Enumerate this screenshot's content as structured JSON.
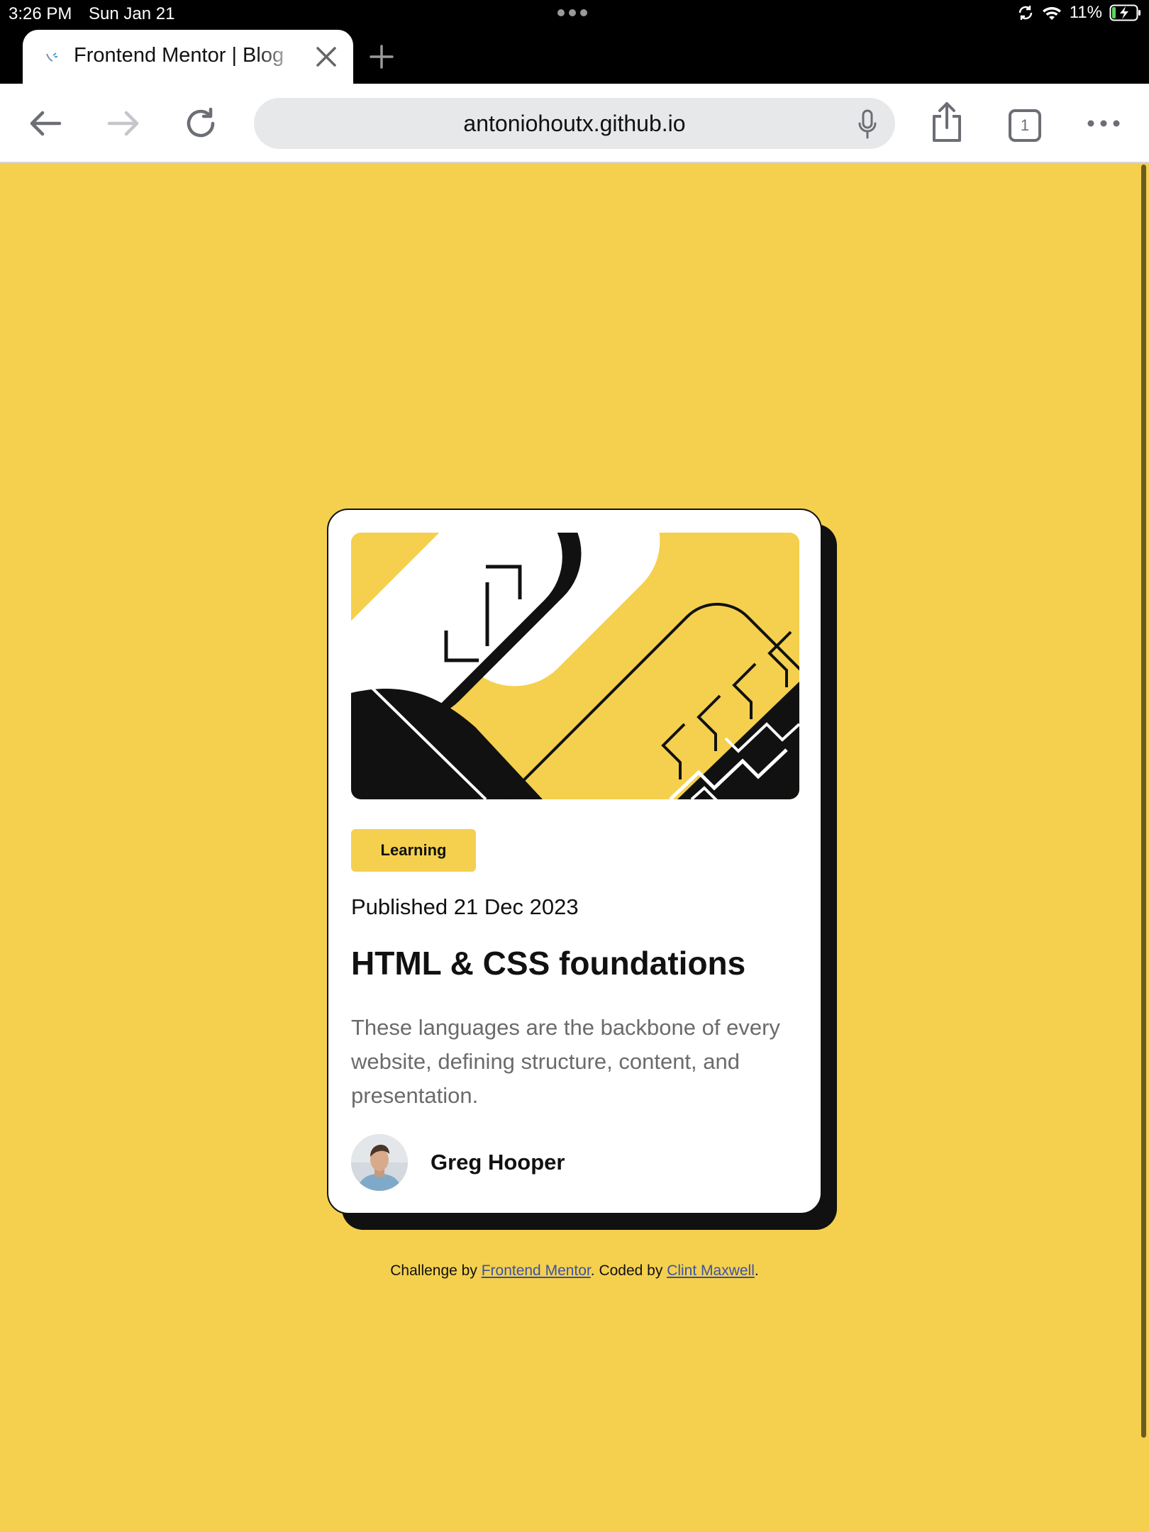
{
  "status_bar": {
    "time": "3:26 PM",
    "date": "Sun Jan 21",
    "battery": "11%"
  },
  "browser": {
    "tab_title": "Frontend Mentor | Blog preview card",
    "url": "antoniohoutx.github.io",
    "tab_count": "1"
  },
  "card": {
    "tag": "Learning",
    "published": "Published 21 Dec 2023",
    "title": "HTML & CSS foundations",
    "description": "These languages are the backbone of every website, defining structure, content, and presentation.",
    "author": "Greg Hooper"
  },
  "attribution": {
    "prefix": "Challenge by ",
    "challenge_link": "Frontend Mentor",
    "middle": ". Coded by ",
    "coder_link": "Clint Maxwell",
    "suffix": "."
  },
  "colors": {
    "background": "#f4d04e",
    "card": "#ffffff",
    "ink": "#111111",
    "muted_text": "#6b6b6b",
    "link": "#3e52a3"
  },
  "icons": {
    "back": "arrow-left-icon",
    "forward": "arrow-right-icon",
    "reload": "reload-icon",
    "share": "share-icon",
    "more": "more-icon",
    "mic": "microphone-icon",
    "wifi": "wifi-icon",
    "battery": "battery-charging-icon",
    "sync": "sync-icon"
  }
}
